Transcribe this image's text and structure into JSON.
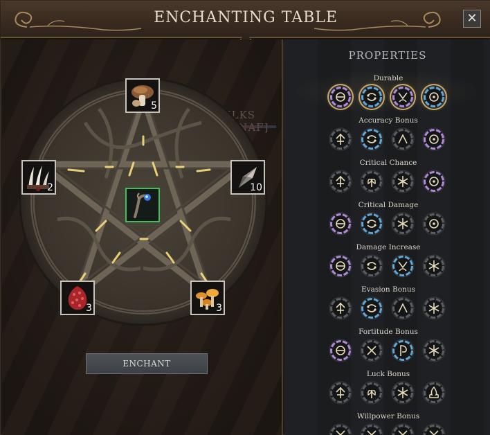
{
  "window": {
    "title": "ENCHANTING TABLE",
    "close_label": "✕"
  },
  "background": {
    "player_tag": "ULKS [MNAF]"
  },
  "slots": [
    {
      "id": "mushroom",
      "count": "5",
      "icon": "brown-mushroom-icon"
    },
    {
      "id": "claws",
      "count": "2",
      "icon": "claws-icon"
    },
    {
      "id": "crystal",
      "count": "10",
      "icon": "crystal-shard-icon"
    },
    {
      "id": "red-pod",
      "count": "3",
      "icon": "red-seed-pod-icon"
    },
    {
      "id": "chanterelle",
      "count": "3",
      "icon": "orange-mushrooms-icon"
    },
    {
      "id": "wand",
      "count": "",
      "icon": "staff-wand-icon"
    }
  ],
  "enchant_button": {
    "label": "ENCHANT"
  },
  "properties": {
    "title": "PROPERTIES",
    "groups": [
      {
        "name": "Durable",
        "runes": [
          [
            "ring-purple",
            "theta"
          ],
          [
            "ring-blue",
            "cancer"
          ],
          [
            "ring-purple",
            "vee"
          ],
          [
            "ring-blue",
            "dot"
          ]
        ],
        "selected": true
      },
      {
        "name": "Accuracy Bonus",
        "runes": [
          [
            "ring-gray",
            "arrow-up"
          ],
          [
            "ring-blue",
            "cancer"
          ],
          [
            "ring-gray",
            "caret"
          ],
          [
            "ring-purple",
            "dot"
          ]
        ]
      },
      {
        "name": "Critical Chance",
        "runes": [
          [
            "ring-gray",
            "arrow-up"
          ],
          [
            "ring-gray",
            "sprout"
          ],
          [
            "ring-gray",
            "snowflake"
          ],
          [
            "ring-purple",
            "dot"
          ]
        ]
      },
      {
        "name": "Critical Damage",
        "runes": [
          [
            "ring-purple",
            "theta"
          ],
          [
            "ring-blue",
            "cancer"
          ],
          [
            "ring-gray",
            "snowflake"
          ],
          [
            "ring-gray",
            "dot"
          ]
        ]
      },
      {
        "name": "Damage Increase",
        "runes": [
          [
            "ring-purple",
            "theta"
          ],
          [
            "ring-gray",
            "cancer"
          ],
          [
            "ring-blue",
            "vee"
          ],
          [
            "ring-gray",
            "snowflake"
          ]
        ]
      },
      {
        "name": "Evasion Bonus",
        "runes": [
          [
            "ring-gray",
            "arrow-up"
          ],
          [
            "ring-blue",
            "cancer"
          ],
          [
            "ring-gray",
            "caret"
          ],
          [
            "ring-gray",
            "snowflake"
          ]
        ]
      },
      {
        "name": "Fortitude Bonus",
        "runes": [
          [
            "ring-purple",
            "theta"
          ],
          [
            "ring-gray",
            "x"
          ],
          [
            "ring-blue",
            "hook"
          ],
          [
            "ring-gray",
            "snowflake"
          ]
        ]
      },
      {
        "name": "Luck Bonus",
        "runes": [
          [
            "ring-gray",
            "arrow-up"
          ],
          [
            "ring-gray",
            "sprout"
          ],
          [
            "ring-gray",
            "snowflake"
          ],
          [
            "ring-gray",
            "flame"
          ]
        ]
      },
      {
        "name": "Willpower Bonus",
        "runes": [
          [
            "ring-gray",
            "x"
          ],
          [
            "ring-gray",
            "x"
          ],
          [
            "ring-gray",
            "x"
          ],
          [
            "ring-gray",
            "x"
          ]
        ]
      }
    ]
  },
  "colors": {
    "ring_purple": "#b08ad8",
    "ring_blue": "#5fa8d8",
    "ring_gray": "#5a5d62",
    "glyph": "#e8dcb8",
    "accent_gold": "#c9a868"
  }
}
